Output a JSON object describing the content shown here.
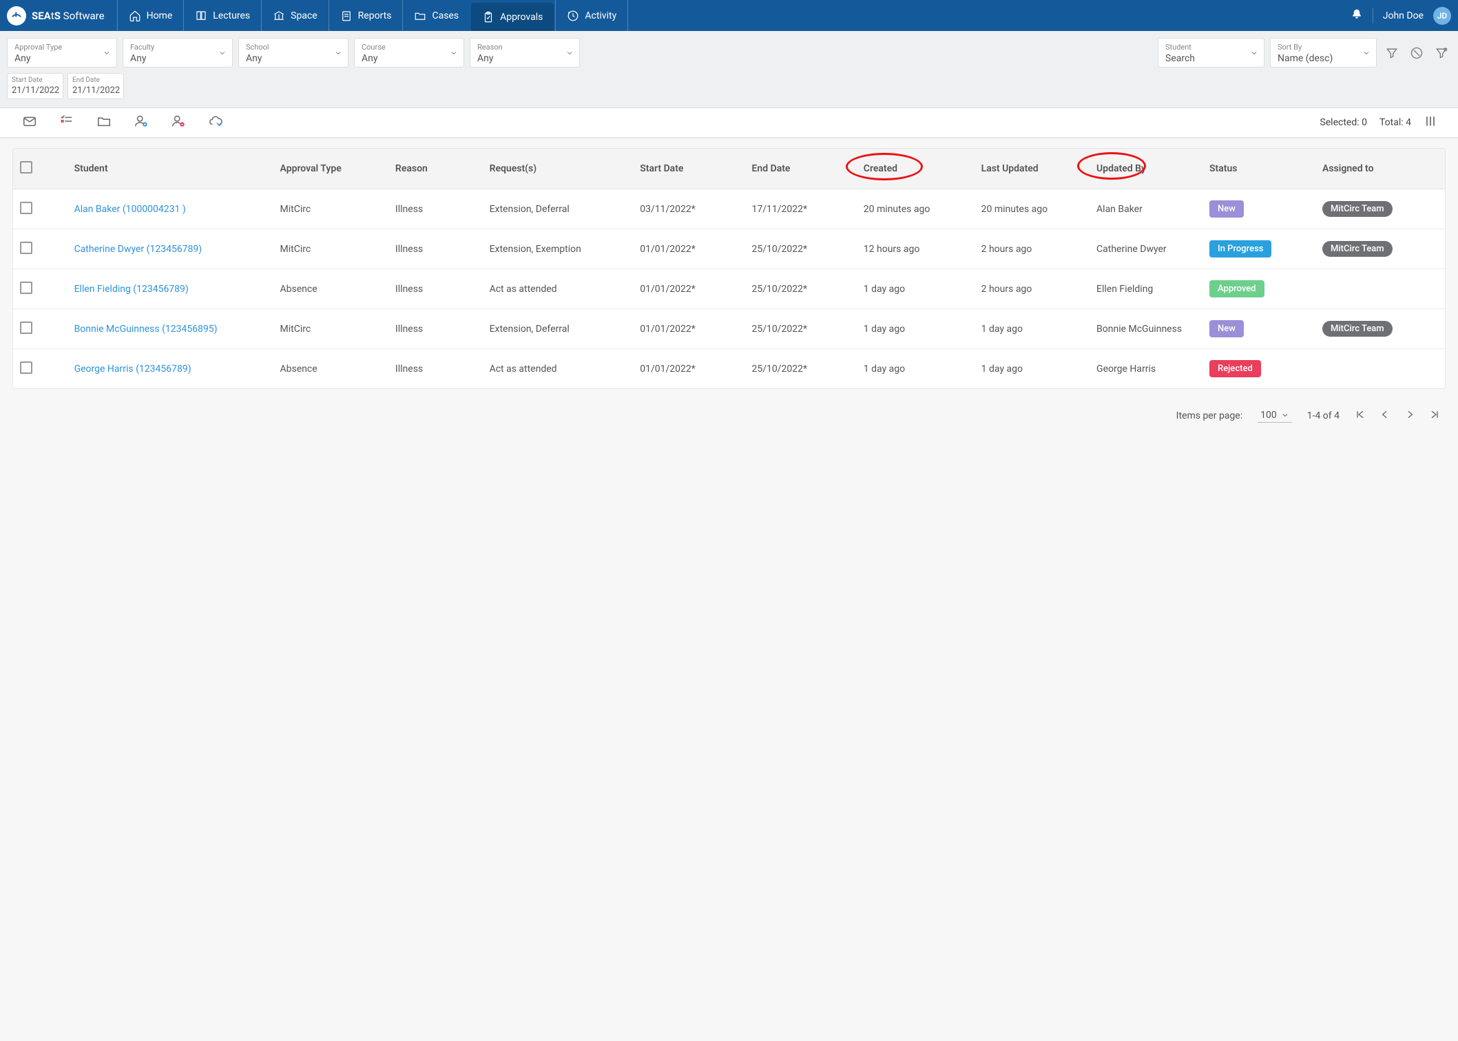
{
  "brand": {
    "name_html": "SEAtS Software",
    "bold_part": "SEA",
    "mid": "t",
    "tail": "S",
    "suffix": " Software"
  },
  "nav": [
    {
      "label": "Home",
      "icon": "home"
    },
    {
      "label": "Lectures",
      "icon": "book"
    },
    {
      "label": "Space",
      "icon": "bank"
    },
    {
      "label": "Reports",
      "icon": "report"
    },
    {
      "label": "Cases",
      "icon": "folder"
    },
    {
      "label": "Approvals",
      "icon": "clipboard",
      "active": true
    },
    {
      "label": "Activity",
      "icon": "clock"
    }
  ],
  "user": {
    "name": "John Doe",
    "initials": "JD"
  },
  "filters": {
    "approval_type": {
      "label": "Approval Type",
      "value": "Any"
    },
    "faculty": {
      "label": "Faculty",
      "value": "Any"
    },
    "school": {
      "label": "School",
      "value": "Any"
    },
    "course": {
      "label": "Course",
      "value": "Any"
    },
    "reason": {
      "label": "Reason",
      "value": "Any"
    },
    "start_date": {
      "label": "Start Date",
      "value": "21/11/2022"
    },
    "end_date": {
      "label": "End Date",
      "value": "21/11/2022"
    },
    "student": {
      "label": "Student",
      "value": "Search"
    },
    "sort_by": {
      "label": "Sort By",
      "value": "Name (desc)"
    }
  },
  "summary": {
    "selected_label": "Selected:",
    "selected": "0",
    "total_label": "Total:",
    "total": "4"
  },
  "columns": {
    "student": "Student",
    "approval_type": "Approval Type",
    "reason": "Reason",
    "requests": "Request(s)",
    "start_date": "Start Date",
    "end_date": "End Date",
    "created": "Created",
    "last_updated": "Last Updated",
    "updated_by": "Updated By",
    "status": "Status",
    "assigned_to": "Assigned to"
  },
  "rows": [
    {
      "student": "Alan Baker (1000004231 )",
      "type": "MitCirc",
      "reason": "Illness",
      "req": "Extension, Deferral",
      "start": "03/11/2022*",
      "end": "17/11/2022*",
      "created": "20 minutes ago",
      "updated": "20 minutes ago",
      "by": "Alan Baker",
      "status": "New",
      "status_class": "badge-new",
      "assigned": "MitCirc Team"
    },
    {
      "student": "Catherine Dwyer  (123456789)",
      "type": "MitCirc",
      "reason": "Illness",
      "req": "Extension, Exemption",
      "start": "01/01/2022*",
      "end": "25/10/2022*",
      "created": "12 hours ago",
      "updated": "2 hours ago",
      "by": "Catherine Dwyer",
      "status": "In Progress",
      "status_class": "badge-progress",
      "assigned": "MitCirc Team"
    },
    {
      "student": "Ellen Fielding (123456789)",
      "type": "Absence",
      "reason": "Illness",
      "req": "Act as attended",
      "start": "01/01/2022*",
      "end": "25/10/2022*",
      "created": "1 day ago",
      "updated": "2 hours ago",
      "by": "Ellen Fielding",
      "status": "Approved",
      "status_class": "badge-approved",
      "assigned": ""
    },
    {
      "student": "Bonnie McGuinness (123456895)",
      "type": "MitCirc",
      "reason": "Illness",
      "req": "Extension, Deferral",
      "start": "01/01/2022*",
      "end": "25/10/2022*",
      "created": "1 day ago",
      "updated": "1 day ago",
      "by": "Bonnie McGuinness",
      "status": "New",
      "status_class": "badge-new",
      "assigned": "MitCirc Team"
    },
    {
      "student": "George Harris (123456789)",
      "type": "Absence",
      "reason": "Illness",
      "req": "Act as attended",
      "start": "01/01/2022*",
      "end": "25/10/2022*",
      "created": "1 day ago",
      "updated": "1 day ago",
      "by": "George Harris",
      "status": "Rejected",
      "status_class": "badge-rejected",
      "assigned": ""
    }
  ],
  "pagination": {
    "items_per_page_label": "Items per page:",
    "items_per_page": "100",
    "range": "1-4 of 4"
  }
}
